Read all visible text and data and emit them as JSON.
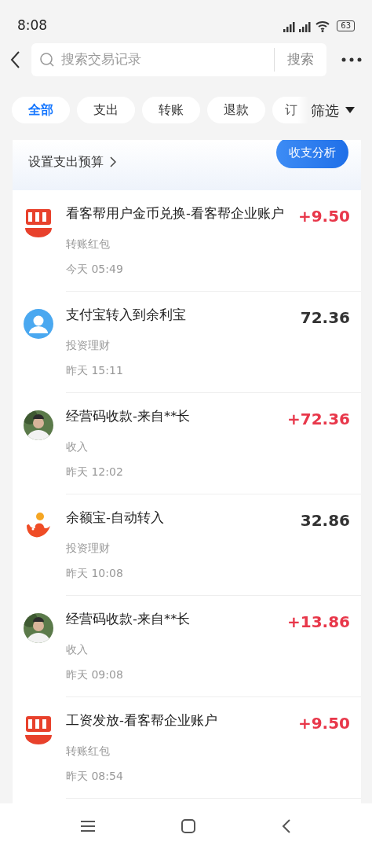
{
  "status_bar": {
    "time": "8:08",
    "battery": "63"
  },
  "search": {
    "placeholder": "搜索交易记录",
    "button": "搜索"
  },
  "chips": [
    {
      "label": "全部",
      "selected": true
    },
    {
      "label": "支出",
      "selected": false
    },
    {
      "label": "转账",
      "selected": false
    },
    {
      "label": "退款",
      "selected": false
    },
    {
      "label": "订",
      "selected": false
    }
  ],
  "filter": {
    "label": "筛选"
  },
  "budget": {
    "label": "设置支出预算",
    "analysis_button": "收支分析"
  },
  "transactions": [
    {
      "kind": "kkb",
      "title": "看客帮用户金币兑换-看客帮企业账户",
      "category": "转账红包",
      "time": "今天 05:49",
      "amount": "+9.50",
      "income": true
    },
    {
      "kind": "person",
      "title": "支付宝转入到余利宝",
      "category": "投资理财",
      "time": "昨天 15:11",
      "amount": "72.36",
      "income": false
    },
    {
      "kind": "photo",
      "title": "经营码收款-来自**长",
      "category": "收入",
      "time": "昨天 12:02",
      "amount": "+72.36",
      "income": true
    },
    {
      "kind": "fish",
      "title": "余额宝-自动转入",
      "category": "投资理财",
      "time": "昨天 10:08",
      "amount": "32.86",
      "income": false
    },
    {
      "kind": "photo",
      "title": "经营码收款-来自**长",
      "category": "收入",
      "time": "昨天 09:08",
      "amount": "+13.86",
      "income": true
    },
    {
      "kind": "kkb",
      "title": "工资发放-看客帮企业账户",
      "category": "转账红包",
      "time": "昨天 08:54",
      "amount": "+9.50",
      "income": true
    }
  ]
}
